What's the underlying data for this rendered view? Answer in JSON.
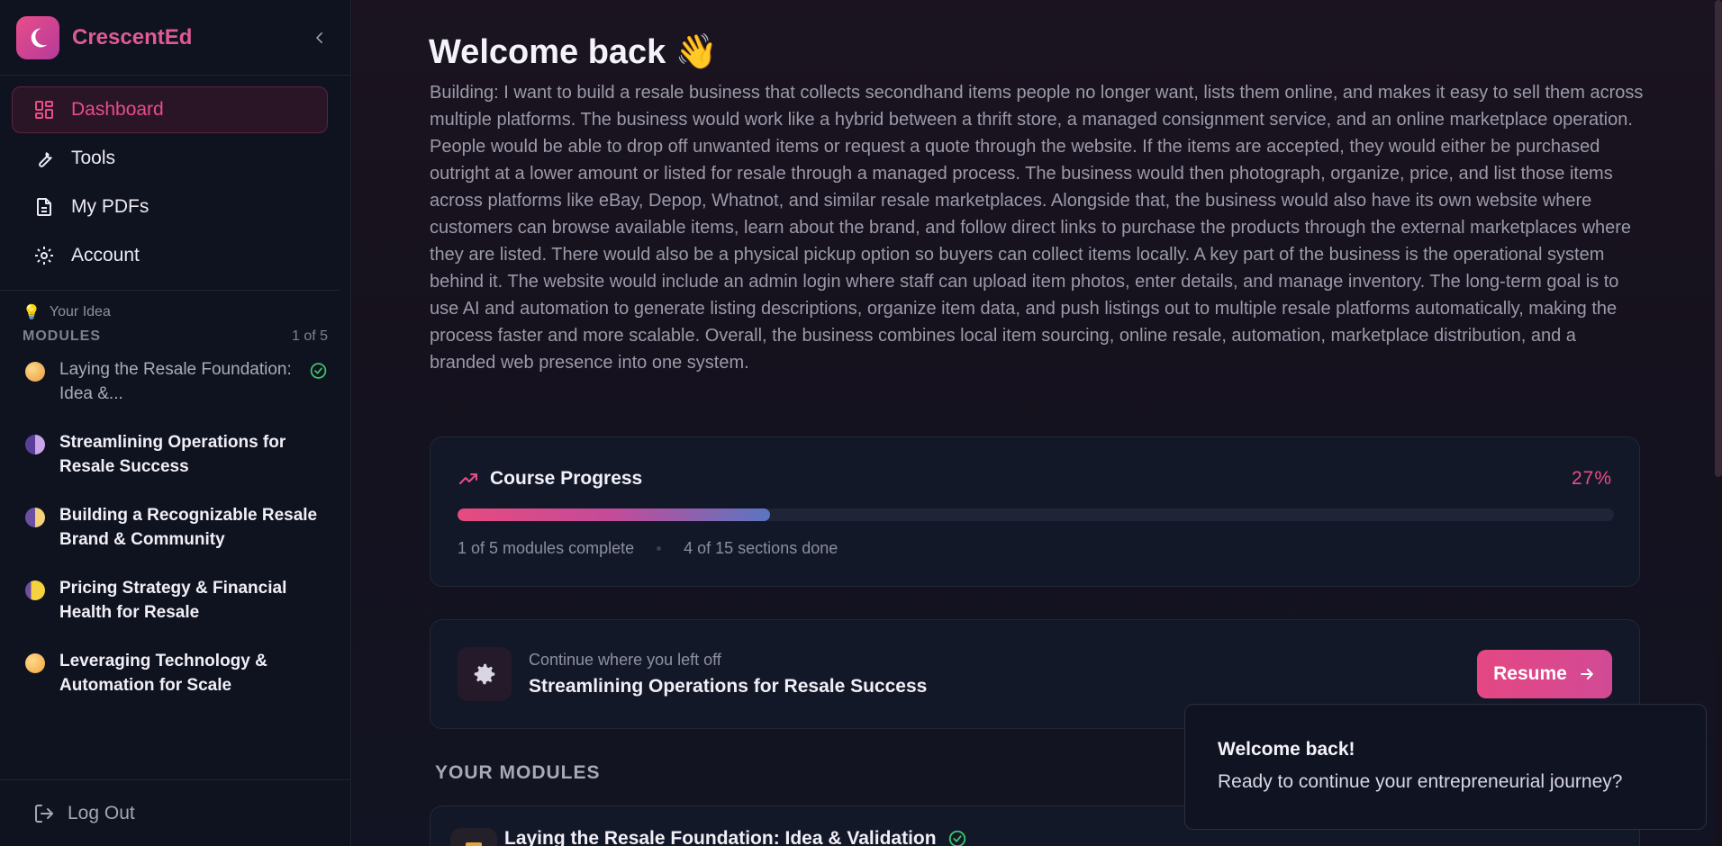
{
  "app": {
    "name": "CrescentEd"
  },
  "nav": {
    "items": [
      {
        "label": "Dashboard",
        "icon": "dashboard-grid-icon",
        "active": true
      },
      {
        "label": "Tools",
        "icon": "wrench-icon"
      },
      {
        "label": "My PDFs",
        "icon": "document-icon"
      },
      {
        "label": "Account",
        "icon": "gear-icon"
      }
    ]
  },
  "sidebar": {
    "idea_label": "Your Idea",
    "modules_heading": "MODULES",
    "modules_count": "1 of 5",
    "modules": [
      {
        "title": "Laying the Resale Foundation: Idea &...",
        "done": true,
        "dot_color": "#f2b25a"
      },
      {
        "title": "Streamlining Operations for Resale Success",
        "done": false,
        "dot_color": "#8a5ac2"
      },
      {
        "title": "Building a Recognizable Resale Brand & Community",
        "done": false,
        "dot_color": "#c9a0e0"
      },
      {
        "title": "Pricing Strategy & Financial Health for Resale",
        "done": false,
        "dot_color": "#f2d040"
      },
      {
        "title": "Leveraging Technology & Automation for Scale",
        "done": false,
        "dot_color": "#f6b54a"
      }
    ],
    "logout_label": "Log Out"
  },
  "main": {
    "welcome_title": "Welcome back 👋",
    "idea_text": "Building: I want to build a resale business that collects secondhand items people no longer want, lists them online, and makes it easy to sell them across multiple platforms. The business would work like a hybrid between a thrift store, a managed consignment service, and an online marketplace operation. People would be able to drop off unwanted items or request a quote through the website. If the items are accepted, they would either be purchased outright at a lower amount or listed for resale through a managed process. The business would then photograph, organize, price, and list those items across platforms like eBay, Depop, Whatnot, and similar resale marketplaces. Alongside that, the business would also have its own website where customers can browse available items, learn about the brand, and follow direct links to purchase the products through the external marketplaces where they are listed. There would also be a physical pickup option so buyers can collect items locally. A key part of the business is the operational system behind it. The website would include an admin login where staff can upload item photos, enter details, and manage inventory. The long-term goal is to use AI and automation to generate listing descriptions, organize item data, and push listings out to multiple resale platforms automatically, making the process faster and more scalable. Overall, the business combines local item sourcing, online resale, automation, marketplace distribution, and a branded web presence into one system.",
    "progress": {
      "title": "Course Progress",
      "percent_label": "27%",
      "percent": 27,
      "modules_complete": "1 of 5 modules complete",
      "sections_done": "4 of 15 sections done"
    },
    "continue": {
      "label": "Continue where you left off",
      "title": "Streamlining Operations for Resale Success",
      "button": "Resume"
    },
    "modules_section": {
      "heading": "YOUR MODULES",
      "first_module": "Laying the Resale Foundation: Idea & Validation"
    }
  },
  "toast": {
    "title": "Welcome back!",
    "message": "Ready to continue your entrepreneurial journey?"
  },
  "colors": {
    "accent": "#e84d86",
    "success": "#3ec46d"
  }
}
